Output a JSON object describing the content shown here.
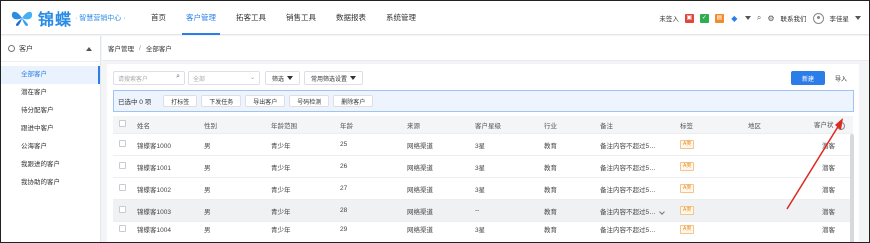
{
  "brand": {
    "logo_text": "锦蝶",
    "logo_sub": "· 智慧营销中心 ·",
    "brand_color": "#2b8ce6"
  },
  "nav": {
    "items": [
      {
        "label": "首页",
        "active": false
      },
      {
        "label": "客户管理",
        "active": true
      },
      {
        "label": "拓客工具",
        "active": false
      },
      {
        "label": "销售工具",
        "active": false
      },
      {
        "label": "数据报表",
        "active": false
      },
      {
        "label": "系统管理",
        "active": false
      }
    ]
  },
  "topright": {
    "status": "未签入",
    "badge_icons": [
      "red-square-icon",
      "green-square-icon",
      "orange-square-icon",
      "blue-square-icon"
    ],
    "contact": "联系我们",
    "user": "李佳星"
  },
  "sidebar": {
    "title": "客户",
    "items": [
      {
        "label": "全部客户",
        "active": true
      },
      {
        "label": "潜在客户",
        "active": false
      },
      {
        "label": "待分配客户",
        "active": false
      },
      {
        "label": "跟进中客户",
        "active": false
      },
      {
        "label": "公海客户",
        "active": false
      },
      {
        "label": "我跟进的客户",
        "active": false
      },
      {
        "label": "我协助的客户",
        "active": false
      }
    ]
  },
  "breadcrumb": {
    "root": "客户管理",
    "sep": "/",
    "current": "全部客户"
  },
  "toolbar": {
    "search_placeholder": "请搜索客户",
    "select_placeholder": "全部",
    "filter_label": "筛选",
    "common_filter_label": "常用筛选设置",
    "new_label": "新建",
    "import_label": "导入"
  },
  "selection": {
    "count_text": "已选中 0 项",
    "actions": [
      "打标签",
      "下发任务",
      "导出客户",
      "号码检测",
      "删除客户"
    ]
  },
  "table": {
    "columns": [
      "姓名",
      "性别",
      "年龄范围",
      "年龄",
      "来源",
      "客户星级",
      "行业",
      "备注",
      "标签",
      "地区",
      "客户状"
    ],
    "rows": [
      {
        "name": "锦蝶客1000",
        "gender": "男",
        "age_range": "青少年",
        "age": "25",
        "source": "网络渠道",
        "stars": "3星",
        "industry": "教育",
        "note": "备注内容不超过5…",
        "tag": "A类",
        "region": "",
        "status": "潜客"
      },
      {
        "name": "锦蝶客1001",
        "gender": "男",
        "age_range": "青少年",
        "age": "26",
        "source": "网络渠道",
        "stars": "3星",
        "industry": "教育",
        "note": "备注内容不超过5…",
        "tag": "A类",
        "region": "",
        "status": "潜客"
      },
      {
        "name": "锦蝶客1002",
        "gender": "男",
        "age_range": "青少年",
        "age": "27",
        "source": "网络渠道",
        "stars": "3星",
        "industry": "教育",
        "note": "备注内容不超过5…",
        "tag": "A类",
        "region": "",
        "status": "潜客"
      },
      {
        "name": "锦蝶客1003",
        "gender": "男",
        "age_range": "青少年",
        "age": "28",
        "source": "网络渠道",
        "stars": "--",
        "industry": "教育",
        "note": "备注内容不超过5…",
        "tag": "A类",
        "region": "",
        "status": "潜客"
      },
      {
        "name": "锦蝶客1004",
        "gender": "男",
        "age_range": "青少年",
        "age": "29",
        "source": "网络渠道",
        "stars": "3星",
        "industry": "教育",
        "note": "备注内容不超过5…",
        "tag": "A类",
        "region": "",
        "status": "潜客"
      }
    ]
  },
  "colors": {
    "accent": "#2b7de9",
    "annotation_arrow": "#e0281e",
    "tag_orange": "#e88a1c"
  }
}
